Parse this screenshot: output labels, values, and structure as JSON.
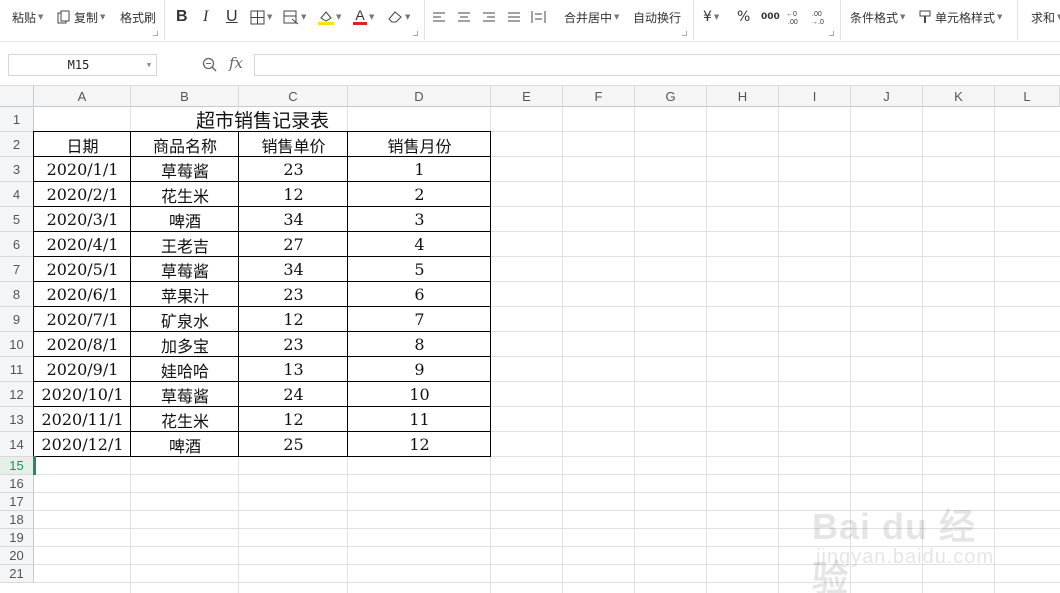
{
  "ribbon": {
    "paste": "粘贴",
    "copy": "复制",
    "format_painter": "格式刷",
    "bold": "B",
    "italic": "I",
    "underline": "U",
    "merge_center": "合并居中",
    "wrap_text": "自动换行",
    "currency": "¥",
    "percent": "%",
    "thousands": "000",
    "cond_format": "条件格式",
    "cell_style": "单元格样式",
    "sum": "求和",
    "font_color": "#e02020",
    "fill_color": "#f5e500"
  },
  "formula_bar": {
    "name_box": "M15",
    "fx": "fx",
    "formula": ""
  },
  "columns": [
    "A",
    "B",
    "C",
    "D",
    "E",
    "F",
    "G",
    "H",
    "I",
    "J",
    "K",
    "L"
  ],
  "rows": [
    "1",
    "2",
    "3",
    "4",
    "5",
    "6",
    "7",
    "8",
    "9",
    "10",
    "11",
    "12",
    "13",
    "14",
    "15",
    "16",
    "17",
    "18",
    "19",
    "20",
    "21"
  ],
  "active_row": "15",
  "sheet": {
    "title": "超市销售记录表",
    "headers": [
      "日期",
      "商品名称",
      "销售单价",
      "销售月份"
    ],
    "data": [
      [
        "2020/1/1",
        "草莓酱",
        "23",
        "1"
      ],
      [
        "2020/2/1",
        "花生米",
        "12",
        "2"
      ],
      [
        "2020/3/1",
        "啤酒",
        "34",
        "3"
      ],
      [
        "2020/4/1",
        "王老吉",
        "27",
        "4"
      ],
      [
        "2020/5/1",
        "草莓酱",
        "34",
        "5"
      ],
      [
        "2020/6/1",
        "苹果汁",
        "23",
        "6"
      ],
      [
        "2020/7/1",
        "矿泉水",
        "12",
        "7"
      ],
      [
        "2020/8/1",
        "加多宝",
        "23",
        "8"
      ],
      [
        "2020/9/1",
        "娃哈哈",
        "13",
        "9"
      ],
      [
        "2020/10/1",
        "草莓酱",
        "24",
        "10"
      ],
      [
        "2020/11/1",
        "花生米",
        "12",
        "11"
      ],
      [
        "2020/12/1",
        "啤酒",
        "25",
        "12"
      ]
    ]
  },
  "watermark": {
    "brand": "Bai du 经验",
    "url": "jingyan.baidu.com"
  }
}
